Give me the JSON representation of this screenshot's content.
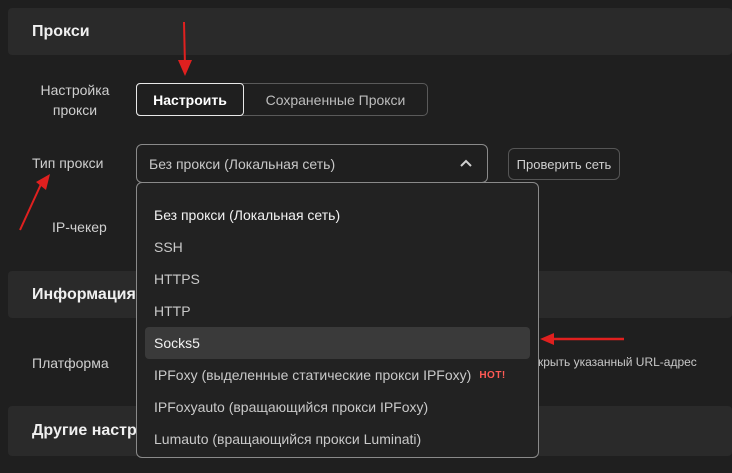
{
  "sections": {
    "proxy": "Прокси",
    "info": "Информация",
    "other": "Другие настр"
  },
  "proxy_settings": {
    "label_line1": "Настройка",
    "label_line2": "прокси",
    "tabs": [
      "Настроить",
      "Сохраненные Прокси"
    ],
    "active_tab": "Настроить"
  },
  "proxy_type": {
    "label": "Тип прокси",
    "selected": "Без прокси (Локальная сеть)",
    "check_button": "Проверить сеть",
    "options": [
      "Без прокси (Локальная сеть)",
      "SSH",
      "HTTPS",
      "HTTP",
      "Socks5",
      "IPFoxy (выделенные статические прокси IPFoxy)",
      "IPFoxyauto (вращающийся прокси IPFoxy)",
      "Lumauto (вращающийся прокси Luminati)"
    ],
    "hovered_option": "Socks5",
    "hot_badge": "HOT!"
  },
  "ip_checker": {
    "label": "IP-чекер"
  },
  "platform": {
    "label": "Платформа",
    "partial_text": "крыть указанный URL-адрес"
  },
  "colors": {
    "background": "#1f1f1f",
    "section_header": "#2a2a2a",
    "annotation_arrow": "#e0201f",
    "hot_badge": "#ff5a55"
  }
}
